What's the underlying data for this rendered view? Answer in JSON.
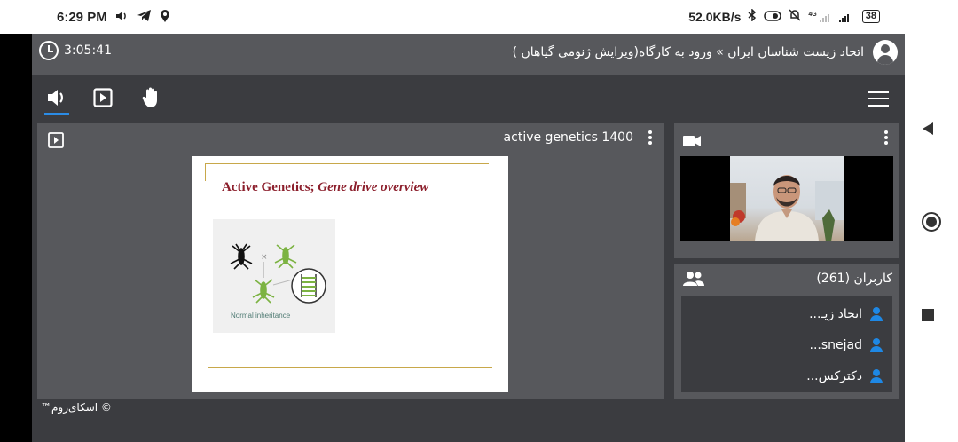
{
  "statusbar": {
    "time": "6:29 PM",
    "network_speed": "52.0KB/s",
    "network_type": "4G",
    "battery": "38"
  },
  "header": {
    "timer": "3:05:41",
    "room_title": "اتحاد زیست شناسان ایران » ورود به کارگاه(ویرایش ژنومی گیاهان )"
  },
  "presentation": {
    "title": "active genetics 1400",
    "slide": {
      "heading_regular": "Active Genetics; ",
      "heading_italic": "Gene drive overview",
      "figure_caption": "Normal inheritance",
      "cross_symbol": "×"
    }
  },
  "users": {
    "title": "کاربران (261)",
    "list": [
      {
        "name": "اتحاد زیـ..."
      },
      {
        "name": "snejad..."
      },
      {
        "name": "دکترکس..."
      }
    ]
  },
  "footer": {
    "copyright": "© اسکای‌روم™"
  },
  "colors": {
    "accent": "#2b8ce6",
    "user_icon": "#1e88e5",
    "heading": "#8c1f2c",
    "panel": "#57585c",
    "background": "#3b3c40"
  }
}
